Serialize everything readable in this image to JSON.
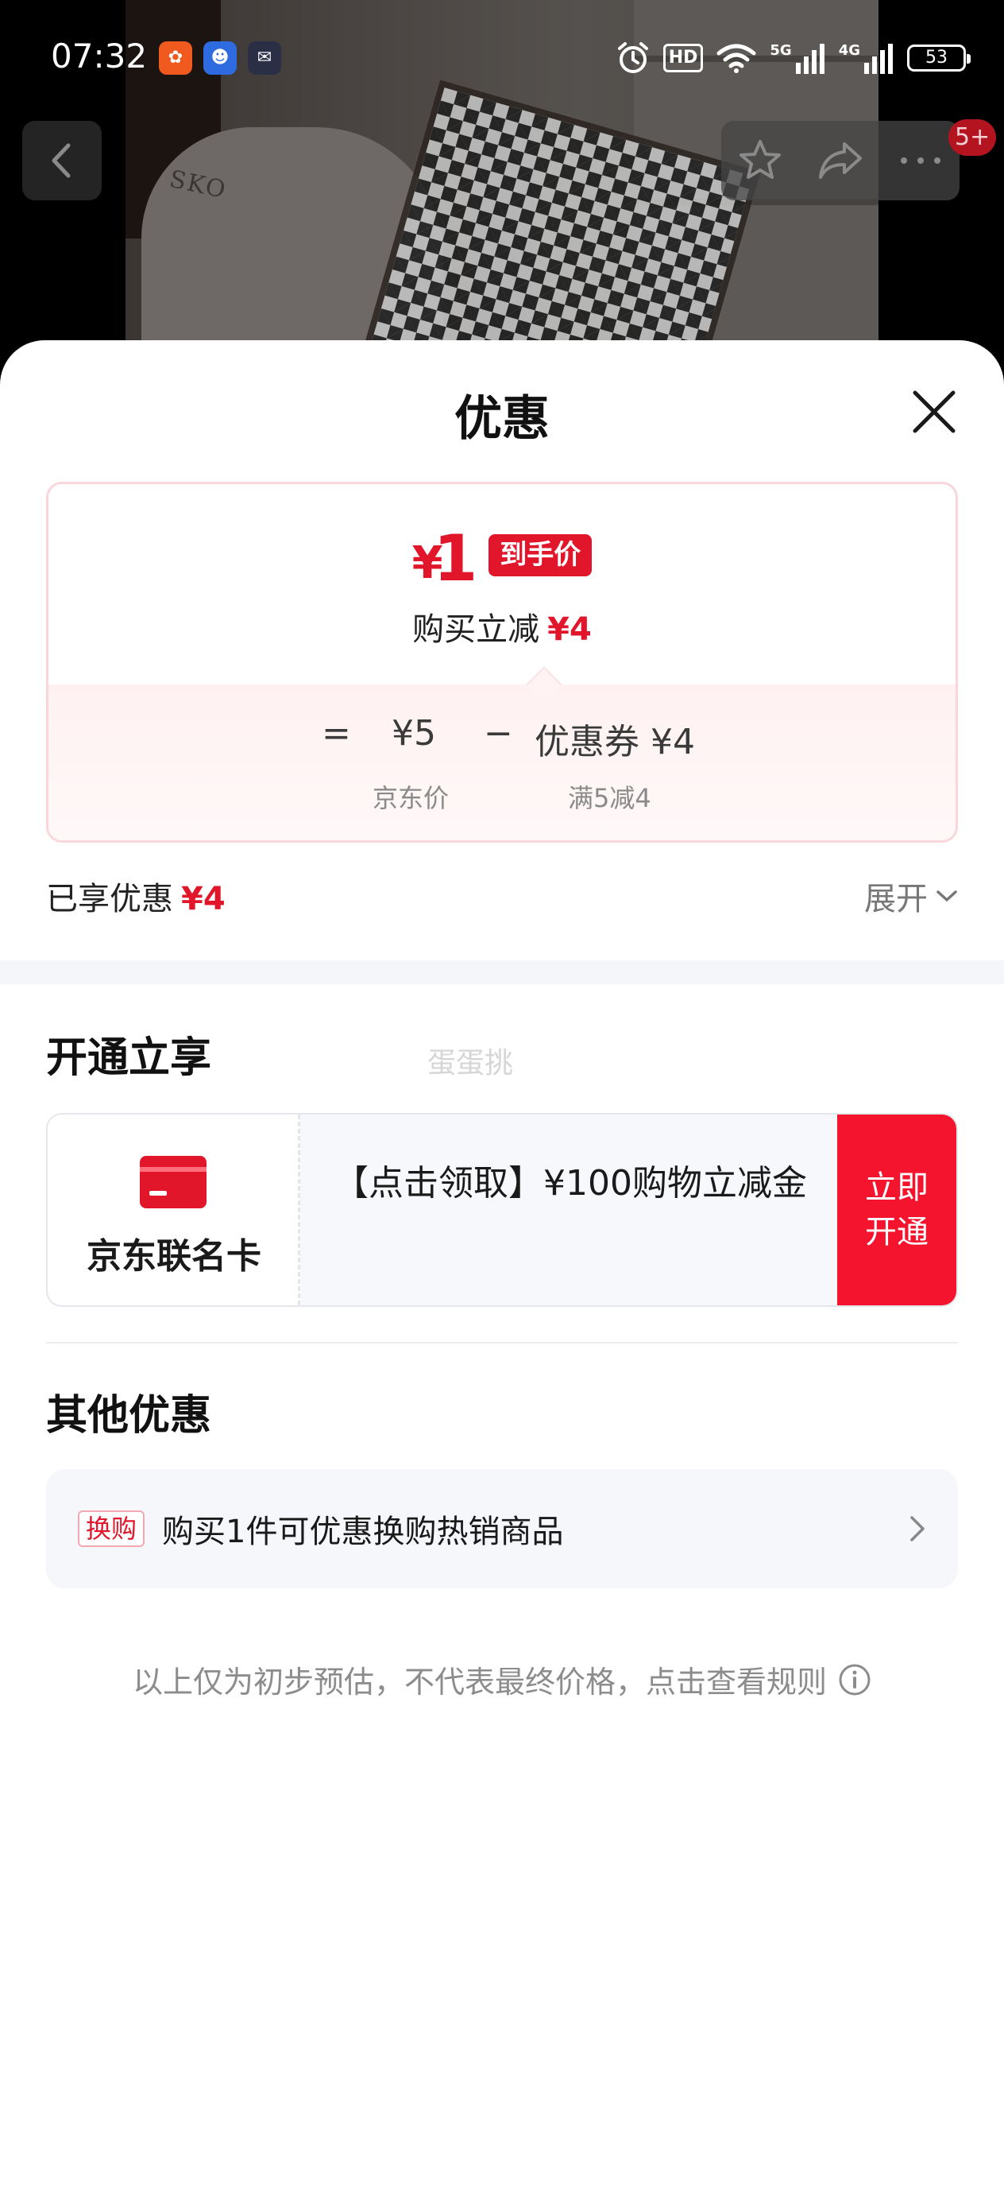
{
  "status_bar": {
    "time": "07:32",
    "hd_label": "HD",
    "network_5g": "5G",
    "network_4g": "4G",
    "battery": "53"
  },
  "background": {
    "sleeve_text": "SKO"
  },
  "nav": {
    "badge": "5+"
  },
  "sheet": {
    "title": "优惠"
  },
  "price_card": {
    "currency": "¥",
    "final_price": "1",
    "final_tag": "到手价",
    "instant_save_label": "购买立减",
    "instant_save_value": "¥4",
    "equals": "=",
    "jd_price": "¥5",
    "minus": "−",
    "coupon": "优惠券 ¥4",
    "jd_price_label": "京东价",
    "coupon_condition": "满5减4"
  },
  "savings": {
    "label": "已享优惠",
    "value": "¥4",
    "expand": "展开"
  },
  "open_section": {
    "title": "开通立享",
    "watermark": "蛋蛋挑",
    "card_name": "京东联名卡",
    "description": "【点击领取】¥100购物立减金",
    "button": "立即开通"
  },
  "other_section": {
    "title": "其他优惠",
    "tag": "换购",
    "text": "购买1件可优惠换购热销商品"
  },
  "disclaimer": "以上仅为初步预估，不代表最终价格，点击查看规则",
  "colors": {
    "accent_red": "#e1162b",
    "button_red": "#f5142e"
  }
}
